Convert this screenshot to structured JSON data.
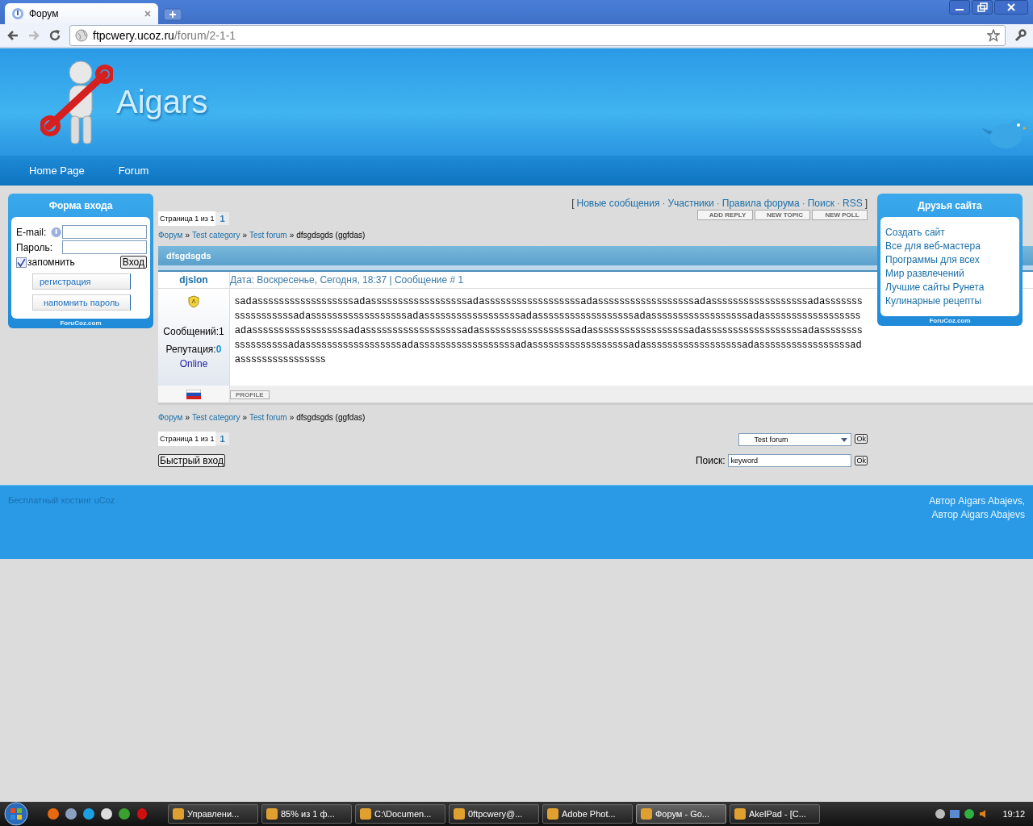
{
  "browser": {
    "tab_title": "Форум",
    "url_host": "ftpcwery.ucoz.ru",
    "url_path": "/forum/2-1-1"
  },
  "header": {
    "site_title": "Aigars"
  },
  "nav": [
    "Home Page",
    "Forum"
  ],
  "login": {
    "title": "Форма входа",
    "email_label": "E-mail:",
    "password_label": "Пароль:",
    "remember": {
      "label": "запомнить",
      "checked": true
    },
    "submit": "Вход",
    "register": "регистрация",
    "remind": "напомнить пароль",
    "footer": "ForuCoz.com"
  },
  "top_links": {
    "open": "[",
    "close": "]",
    "separator": "·",
    "links": [
      "Новые сообщения",
      "Участники",
      "Правила форума",
      "Поиск",
      "RSS"
    ]
  },
  "pager_top": {
    "label": "Страница 1 из 1",
    "pages": [
      {
        "label": "1",
        "selected": false
      }
    ]
  },
  "action_buttons": [
    "ADD REPLY",
    "NEW TOPIC",
    "NEW POLL"
  ],
  "breadcrumbs_top": {
    "separator": "»",
    "links": [
      "Форум",
      "Test category",
      "Test forum"
    ],
    "current": "dfsgdsgds (ggfdas)"
  },
  "topic": {
    "title": "dfsgdsgds"
  },
  "post": {
    "author": "djslon",
    "meta": "Дата: Воскресенье, Сегодня, 18:37 | Сообщение # 1",
    "messages": "Сообщений:1",
    "reputation_label": "Репутация:",
    "reputation": "0",
    "status": "Online",
    "body": "sadassssssssssssssssssadassssssssssssssssssadassssssssssssssssssadassssssssssssssssssadassssssssssssssssssadassssssssssssssssssadassssssssssssssssssadassssssssssssssssssadassssssssssssssssssadassssssssssssssssssadassssssssssssssssssadassssssssssssssssssadassssssssssssssssssadassssssssssssssssssadassssssssssssssssssadassssssssssssssssssadassssssssssssssssssadassssssssssssssssssadassssssssssssssssssadassssssssssssssssssadassssssssssssssssssadasssssssssssssssssadassssssssssssssss",
    "profile_button": "PROFILE"
  },
  "breadcrumbs_bottom": {
    "separator": "»",
    "links": [
      "Форум",
      "Test category",
      "Test forum"
    ],
    "current": "dfsgdsgds (ggfdas)"
  },
  "pager_bottom": {
    "label": "Страница 1 из 1",
    "pages": [
      {
        "label": "1",
        "selected": false
      }
    ]
  },
  "quick_login": "Быстрый вход",
  "forum_select": {
    "value": "Test forum",
    "ok": "Ok"
  },
  "search": {
    "label": "Поиск:",
    "value": "keyword",
    "ok": "Ok"
  },
  "friends": {
    "title": "Друзья сайта",
    "links": [
      "Создать сайт",
      "Все для веб-мастера",
      "Программы для всех",
      "Мир развлечений",
      "Лучшие сайты Рунета",
      "Кулинарные рецепты"
    ],
    "footer": "ForuCoz.com"
  },
  "footer": {
    "left": "Бесплатный хостинг uCoz",
    "right": [
      "Автор Aigars Abajevs,",
      "Автор Aigars Abajevs"
    ]
  },
  "taskbar": {
    "items": [
      {
        "label": "Управлени...",
        "selected": false
      },
      {
        "label": "85% из 1 ф...",
        "selected": false
      },
      {
        "label": "C:\\Documen...",
        "selected": false
      },
      {
        "label": "0ftpcwery@...",
        "selected": false
      },
      {
        "label": "Adobe Phot...",
        "selected": false
      },
      {
        "label": "Форум - Go...",
        "selected": true
      },
      {
        "label": "AkelPad - [C...",
        "selected": false
      }
    ],
    "clock": "19:12"
  }
}
